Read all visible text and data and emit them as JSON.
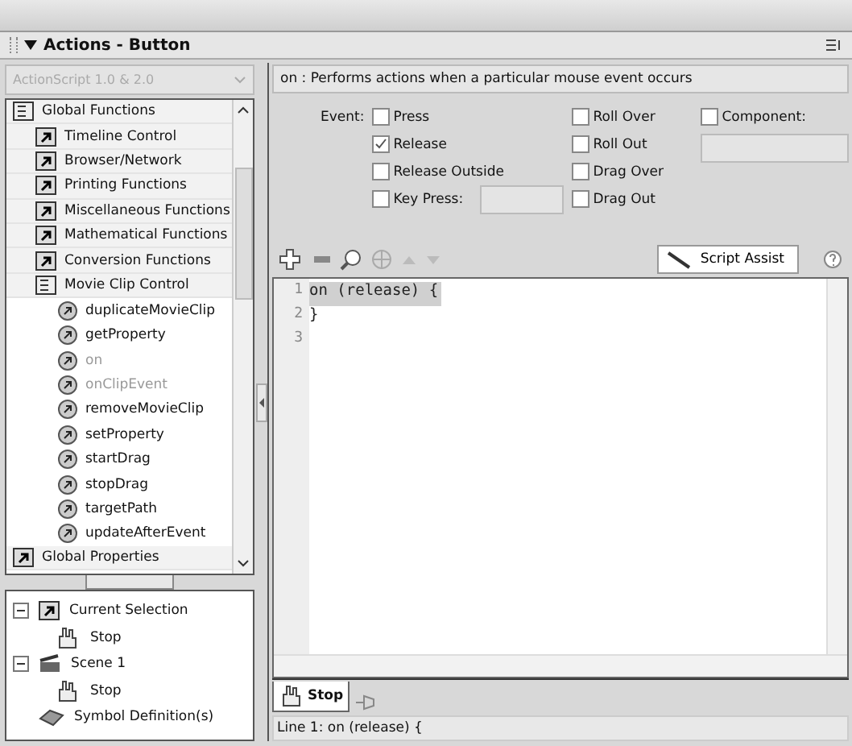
{
  "panel": {
    "title": "Actions - Button",
    "expanded": true
  },
  "version_dropdown": {
    "value": "ActionScript 1.0 & 2.0",
    "disabled": true
  },
  "toolbox": [
    {
      "label": "Global Functions",
      "kind": "book",
      "children": [
        {
          "label": "Timeline Control",
          "kind": "category"
        },
        {
          "label": "Browser/Network",
          "kind": "category"
        },
        {
          "label": "Printing Functions",
          "kind": "category"
        },
        {
          "label": "Miscellaneous Functions",
          "kind": "category"
        },
        {
          "label": "Mathematical Functions",
          "kind": "category"
        },
        {
          "label": "Conversion Functions",
          "kind": "category"
        },
        {
          "label": "Movie Clip Control",
          "kind": "book",
          "children": [
            {
              "label": "duplicateMovieClip",
              "kind": "function",
              "disabled": false
            },
            {
              "label": "getProperty",
              "kind": "function",
              "disabled": false
            },
            {
              "label": "on",
              "kind": "function",
              "disabled": true
            },
            {
              "label": "onClipEvent",
              "kind": "function",
              "disabled": true
            },
            {
              "label": "removeMovieClip",
              "kind": "function",
              "disabled": false
            },
            {
              "label": "setProperty",
              "kind": "function",
              "disabled": false
            },
            {
              "label": "startDrag",
              "kind": "function",
              "disabled": false
            },
            {
              "label": "stopDrag",
              "kind": "function",
              "disabled": false
            },
            {
              "label": "targetPath",
              "kind": "function",
              "disabled": false
            },
            {
              "label": "updateAfterEvent",
              "kind": "function",
              "disabled": false
            }
          ]
        }
      ]
    },
    {
      "label": "Global Properties",
      "kind": "category"
    }
  ],
  "script_navigator": [
    {
      "label": "Current Selection",
      "kind": "category",
      "expanded": true,
      "children": [
        {
          "label": "Stop",
          "kind": "button"
        }
      ]
    },
    {
      "label": "Scene 1",
      "kind": "scene",
      "expanded": true,
      "children": [
        {
          "label": "Stop",
          "kind": "button"
        }
      ]
    },
    {
      "label": "Symbol Definition(s)",
      "kind": "symbols"
    }
  ],
  "description": "on : Performs actions when a particular mouse event occurs",
  "event_label": "Event:",
  "events": [
    {
      "label": "Press",
      "checked": false
    },
    {
      "label": "Release",
      "checked": true
    },
    {
      "label": "Release Outside",
      "checked": false
    },
    {
      "label": "Key Press:",
      "checked": false,
      "kind": "key"
    },
    {
      "label": "Roll Over",
      "checked": false
    },
    {
      "label": "Roll Out",
      "checked": false
    },
    {
      "label": "Drag Over",
      "checked": false
    },
    {
      "label": "Drag Out",
      "checked": false
    }
  ],
  "component": {
    "label": "Component:",
    "checked": false
  },
  "script_assist": {
    "label": "Script Assist"
  },
  "code_lines": [
    {
      "number": "1",
      "text": "on (release) {",
      "highlighted": true
    },
    {
      "number": "2",
      "text": "}",
      "highlighted": false
    },
    {
      "number": "3",
      "highlighted": false
    }
  ],
  "script_tabs": [
    {
      "label": "Stop",
      "selected": true
    }
  ],
  "status_bar": "Line 1: on (release) {"
}
